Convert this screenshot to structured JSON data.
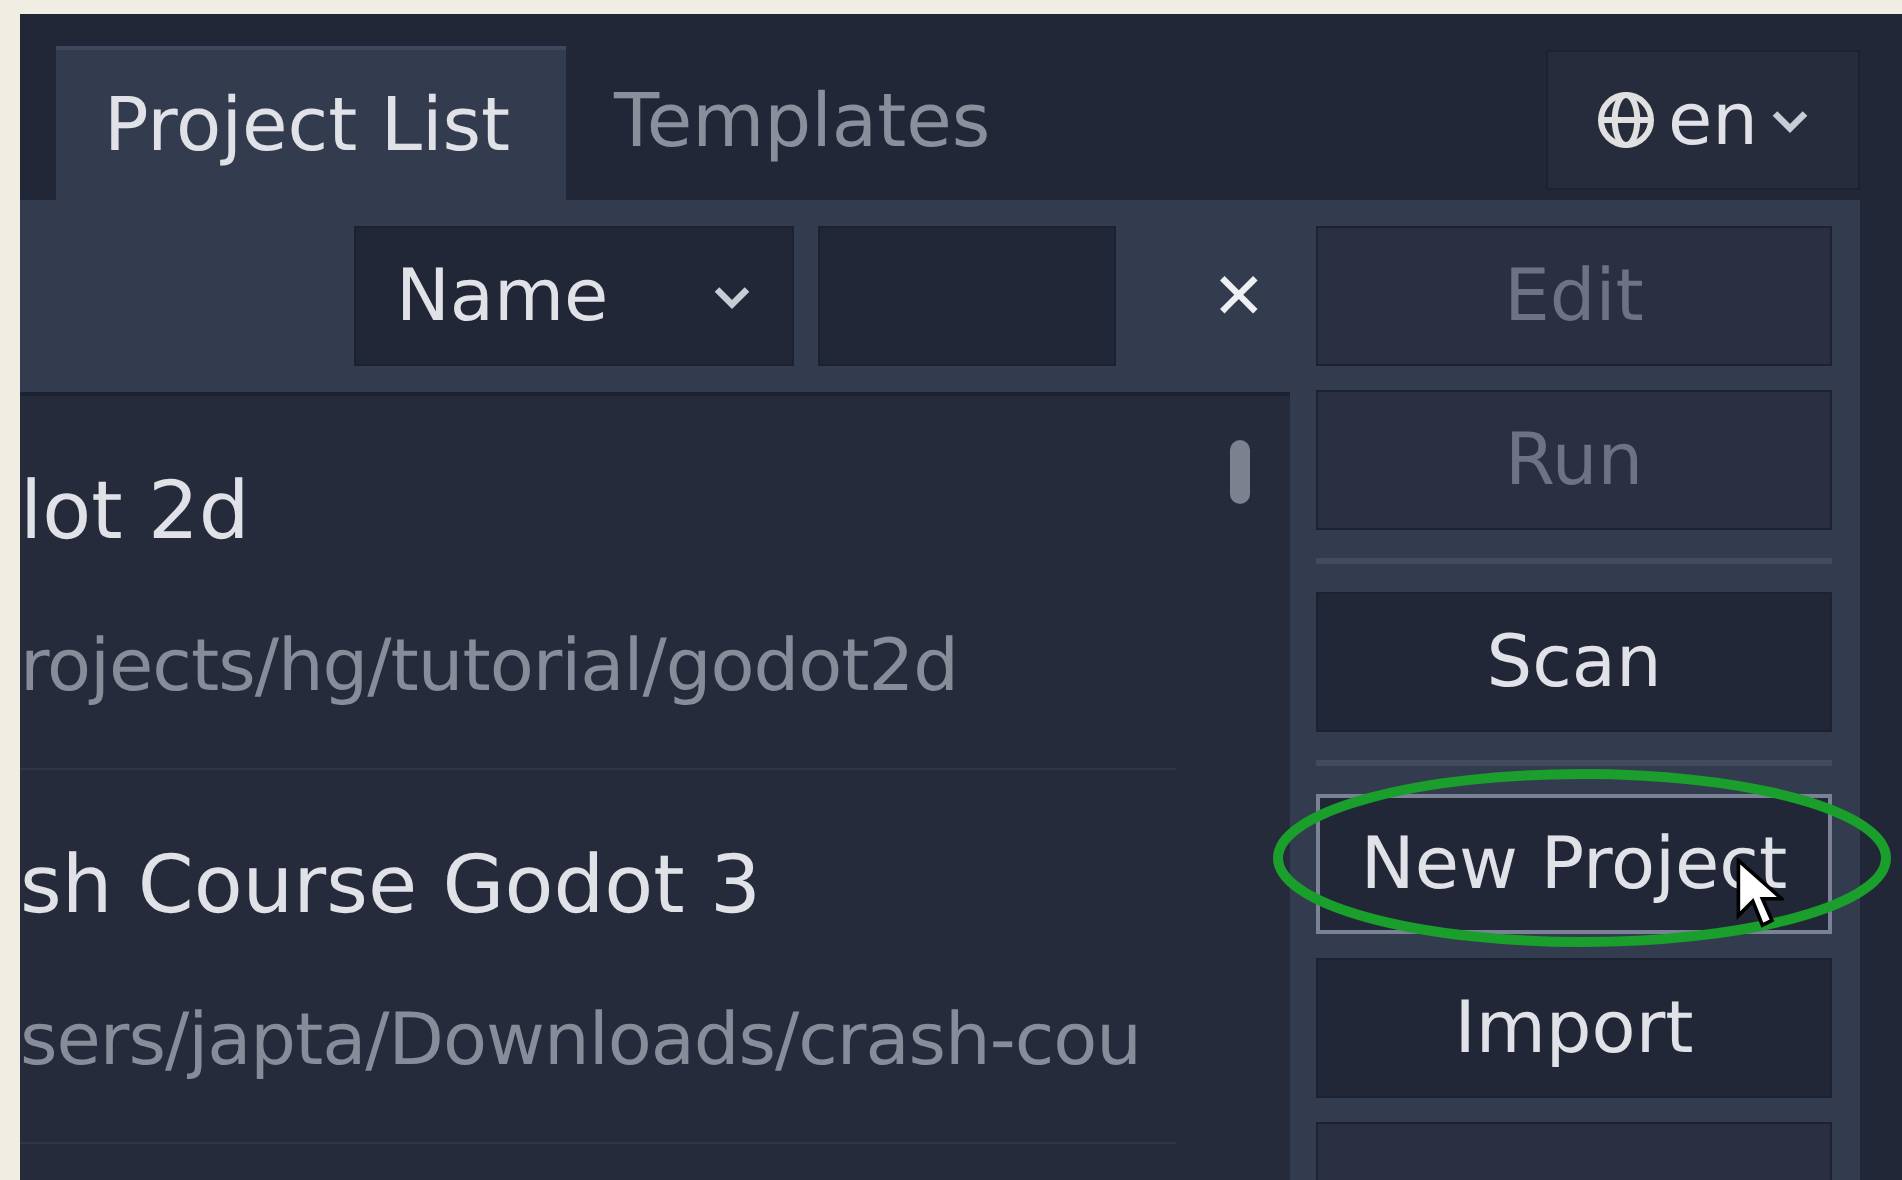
{
  "tabs": [
    {
      "label": "Project List",
      "selected": true
    },
    {
      "label": "Templates",
      "selected": false
    }
  ],
  "language": {
    "label": "en"
  },
  "toolbar": {
    "sort": {
      "value": "Name"
    },
    "clear": "✕"
  },
  "projects": [
    {
      "name": "lot 2d",
      "path": "rojects/hg/tutorial/godot2d"
    },
    {
      "name": "sh Course Godot 3",
      "path": "sers/japta/Downloads/crash-cou"
    }
  ],
  "buttons": [
    {
      "label": "Edit",
      "disabled": true,
      "hovered": false,
      "separator_after": false
    },
    {
      "label": "Run",
      "disabled": true,
      "hovered": false,
      "separator_after": true
    },
    {
      "label": "Scan",
      "disabled": false,
      "hovered": false,
      "separator_after": true
    },
    {
      "label": "New Project",
      "disabled": false,
      "hovered": true,
      "separator_after": false
    },
    {
      "label": "Import",
      "disabled": false,
      "hovered": false,
      "separator_after": false
    }
  ]
}
